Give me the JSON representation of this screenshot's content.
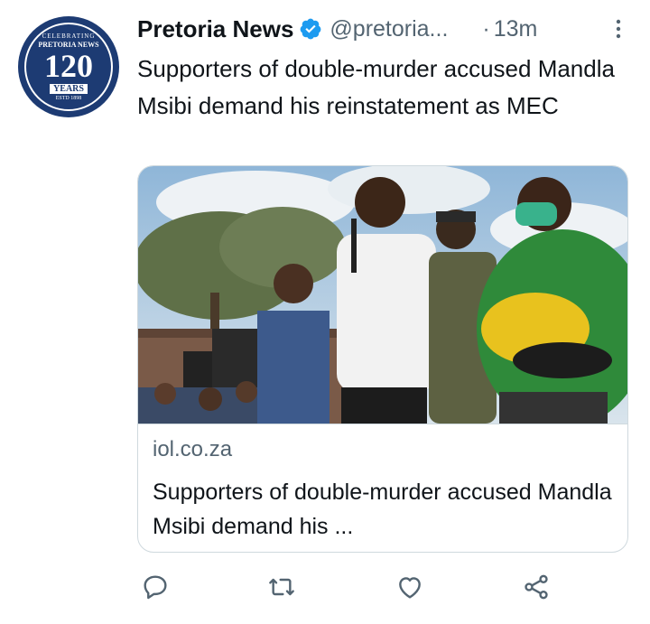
{
  "account": {
    "name": "Pretoria News",
    "handle": "@pretoria...",
    "separator": "·",
    "time": "13m",
    "avatar": {
      "top_text": "CELEBRATING",
      "name_text": "PRETORIA NEWS",
      "number": "120",
      "years": "YEARS",
      "est": "ESTD 1898"
    }
  },
  "tweet": {
    "text": "Supporters of double-murder accused Mandla Msibi demand his reinstatement as MEC"
  },
  "card": {
    "domain": "iol.co.za",
    "title": "Supporters of double-murder accused Mandla Msibi demand his ..."
  },
  "icons": {
    "verified": "verified-badge-icon",
    "more": "more-options-icon",
    "reply": "reply-icon",
    "retweet": "retweet-icon",
    "like": "like-icon",
    "share": "share-icon"
  },
  "colors": {
    "text": "#0f1419",
    "secondary": "#536471",
    "verified": "#1d9bf0",
    "border": "#cfd9de",
    "avatar_bg": "#1d3b73"
  }
}
